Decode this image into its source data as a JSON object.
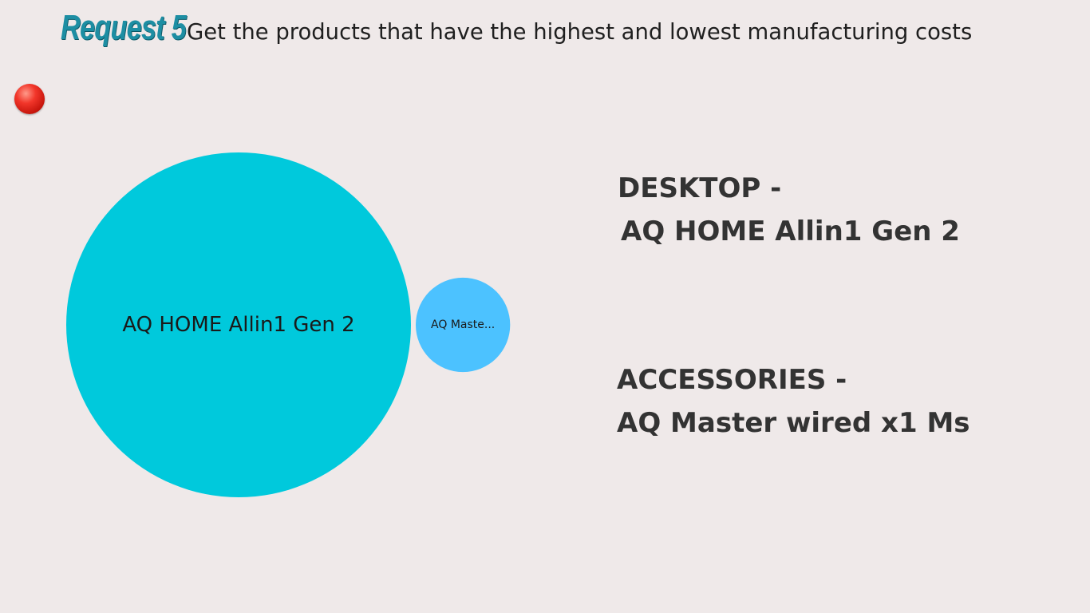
{
  "header": {
    "request_label": "Request 5",
    "description": "Get the products that have the highest and lowest manufacturing costs"
  },
  "colors": {
    "background": "#efe9e9",
    "title_accent": "#1d8ea3",
    "bubble_primary": "#00c9dc",
    "bubble_secondary": "#4cc2ff",
    "record_icon": "#e02418"
  },
  "icons": {
    "record_icon": "red-circle-icon"
  },
  "chart_data": {
    "type": "bubble",
    "legend": "none",
    "bubbles": [
      {
        "label": "AQ HOME Allin1 Gen 2",
        "relative_size": 1.0,
        "color": "#00c9dc"
      },
      {
        "label": "AQ Maste...",
        "relative_size": 0.075,
        "color": "#4cc2ff"
      }
    ]
  },
  "summary": {
    "highest": {
      "category": "DESKTOP -",
      "product": "AQ HOME Allin1 Gen 2"
    },
    "lowest": {
      "category": "ACCESSORIES -",
      "product": "AQ Master wired x1 Ms"
    }
  }
}
